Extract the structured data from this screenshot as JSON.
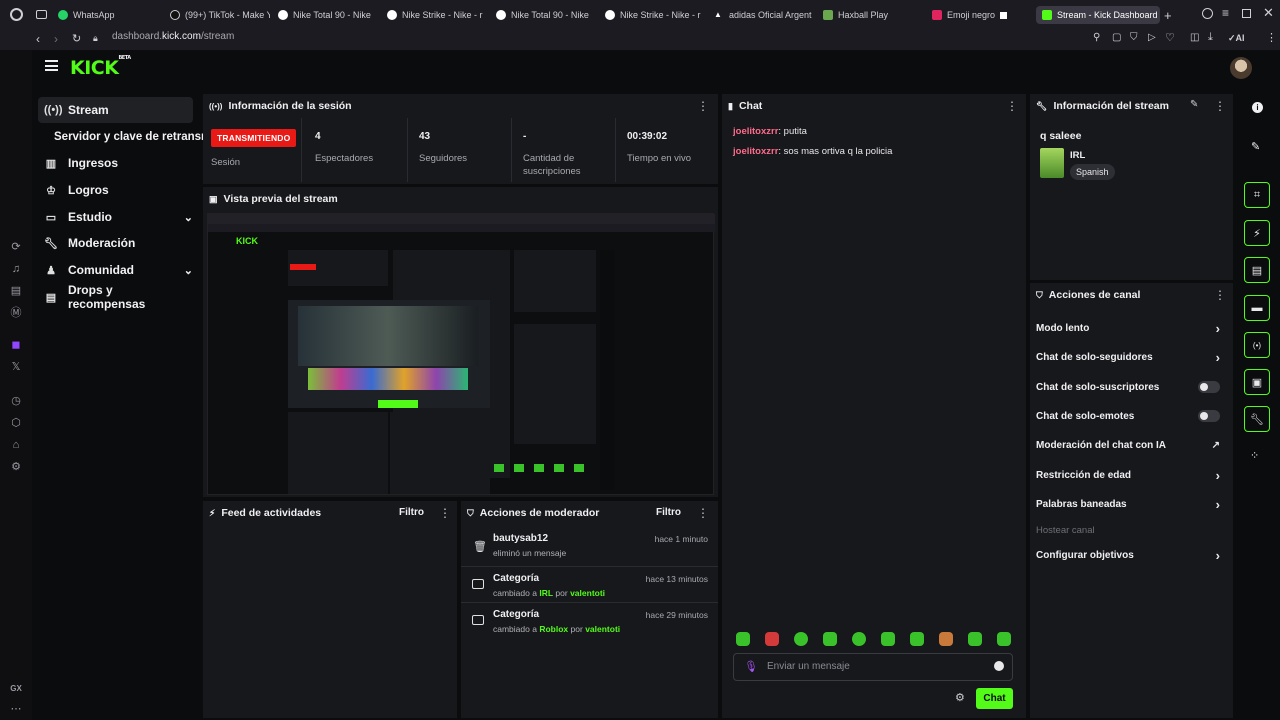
{
  "browser": {
    "tabs": [
      {
        "label": "WhatsApp",
        "icon": "whatsapp-icon"
      },
      {
        "label": "(99+) TikTok - Make Y",
        "icon": "tiktok-icon"
      },
      {
        "label": "Nike Total 90 - Nike",
        "icon": "nike-icon"
      },
      {
        "label": "Nike Strike - Nike - r",
        "icon": "nike-icon"
      },
      {
        "label": "Nike Total 90 - Nike",
        "icon": "nike-icon"
      },
      {
        "label": "Nike Strike - Nike - r",
        "icon": "nike-icon"
      },
      {
        "label": "adidas Oficial Argent",
        "icon": "adidas-icon"
      },
      {
        "label": "Haxball Play",
        "icon": "haxball-icon"
      },
      {
        "label": "Emoji negro",
        "icon": "emoji-icon"
      },
      {
        "label": "Stream - Kick Dashboard",
        "icon": "kick-icon"
      }
    ],
    "url_prefix": "dashboard.",
    "url_domain": "kick.com",
    "url_path": "/stream",
    "ai_label": "AI",
    "gx_label": "GX"
  },
  "sidebar": {
    "items": [
      {
        "label": "Stream",
        "icon": "broadcast-icon"
      },
      {
        "label": "Servidor y clave de retransmisión"
      },
      {
        "label": "Ingresos",
        "icon": "chart-icon"
      },
      {
        "label": "Logros",
        "icon": "trophy-icon"
      },
      {
        "label": "Estudio",
        "icon": "studio-icon"
      },
      {
        "label": "Moderación",
        "icon": "wrench-icon"
      },
      {
        "label": "Comunidad",
        "icon": "community-icon"
      },
      {
        "label": "Drops y recompensas",
        "icon": "drops-icon"
      }
    ]
  },
  "logo": {
    "text": "KICK",
    "beta": "BETA"
  },
  "session": {
    "title": "Información de la sesión",
    "status_badge": "TRANSMITIENDO",
    "status_label": "Sesión",
    "viewers_value": "4",
    "viewers_label": "Espectadores",
    "followers_value": "43",
    "followers_label": "Seguidores",
    "subs_value": "-",
    "subs_label": "Cantidad de suscripciones",
    "uptime_value": "00:39:02",
    "uptime_label": "Tiempo en vivo"
  },
  "preview": {
    "title": "Vista previa del stream"
  },
  "feed": {
    "title": "Feed de actividades",
    "filter": "Filtro"
  },
  "modactions": {
    "title": "Acciones de moderador",
    "filter": "Filtro",
    "rows": [
      {
        "title": "bautysab12",
        "time": "hace 1 minuto",
        "sub": "eliminó un mensaje"
      },
      {
        "title": "Categoría",
        "time": "hace 13 minutos",
        "sub_prefix": "cambiado a",
        "category": "IRL",
        "by": "por",
        "user": "valentoti"
      },
      {
        "title": "Categoría",
        "time": "hace 29 minutos",
        "sub_prefix": "cambiado a",
        "category": "Roblox",
        "by": "por",
        "user": "valentoti"
      }
    ]
  },
  "chat": {
    "title": "Chat",
    "messages": [
      {
        "user": "joelitoxzrr",
        "text": ": putita"
      },
      {
        "user": "joelitoxzrr",
        "text": ": sos mas ortiva q la policia"
      }
    ],
    "input_placeholder": "Enviar un mensaje",
    "send_label": "Chat"
  },
  "streaminfo": {
    "title": "Información del stream",
    "stream_title": "q saleee",
    "category": "IRL",
    "tag": "Spanish"
  },
  "channel_actions": {
    "title": "Acciones de canal",
    "items": [
      {
        "label": "Modo lento",
        "control": "chevron"
      },
      {
        "label": "Chat de solo-seguidores",
        "control": "chevron"
      },
      {
        "label": "Chat de solo-suscriptores",
        "control": "toggle"
      },
      {
        "label": "Chat de solo-emotes",
        "control": "toggle"
      },
      {
        "label": "Moderación del chat con IA",
        "control": "external"
      },
      {
        "label": "Restricción de edad",
        "control": "chevron"
      },
      {
        "label": "Palabras baneadas",
        "control": "chevron"
      },
      {
        "label": "Hostear canal",
        "control": "none"
      },
      {
        "label": "Configurar objetivos",
        "control": "chevron"
      }
    ]
  },
  "colors": {
    "accent": "#53fc18",
    "live": "#e91916",
    "chat_user": "#ff6b8b"
  }
}
